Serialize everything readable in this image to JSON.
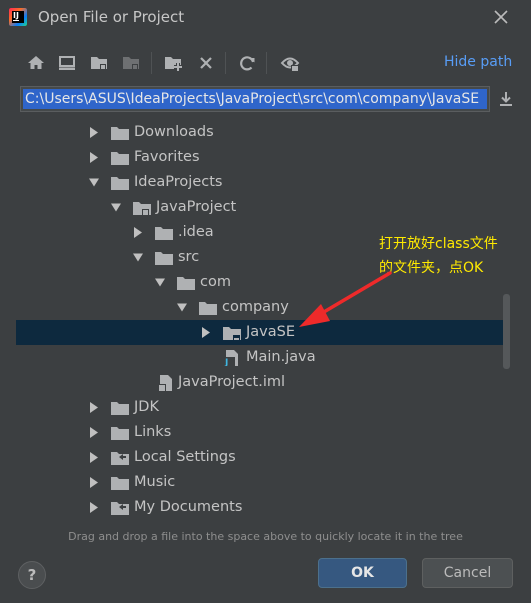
{
  "window": {
    "title": "Open File or Project",
    "close_icon": "close-icon"
  },
  "toolbar": {
    "icons": [
      "home-icon",
      "desktop-icon",
      "project-folder-icon",
      "module-folder-icon",
      "new-folder-icon",
      "delete-icon",
      "refresh-icon",
      "show-hidden-icon"
    ],
    "hide_path_label": "Hide path"
  },
  "path_field": {
    "value": "C:\\Users\\ASUS\\IdeaProjects\\JavaProject\\src\\com\\company\\JavaSE"
  },
  "tree": {
    "rows": [
      {
        "label": "Downloads"
      },
      {
        "label": "Favorites"
      },
      {
        "label": "IdeaProjects"
      },
      {
        "label": "JavaProject"
      },
      {
        "label": ".idea"
      },
      {
        "label": "src"
      },
      {
        "label": "com"
      },
      {
        "label": "company"
      },
      {
        "label": "JavaSE",
        "selected": true
      },
      {
        "label": "Main.java"
      },
      {
        "label": "JavaProject.iml"
      },
      {
        "label": "JDK"
      },
      {
        "label": "Links"
      },
      {
        "label": "Local Settings"
      },
      {
        "label": "Music"
      },
      {
        "label": "My Documents"
      }
    ]
  },
  "annotation": {
    "line1": "打开放好class文件",
    "line2": "的文件夹，点OK",
    "color": "#ffea00"
  },
  "hint": "Drag and drop a file into the space above to quickly locate it in the tree",
  "buttons": {
    "help": "?",
    "ok": "OK",
    "cancel": "Cancel"
  },
  "colors": {
    "background": "#3c3f41",
    "selection": "#0d293e",
    "path_selection": "#2f65ca",
    "link": "#589df6",
    "ok_button": "#365880",
    "arrow": "#ee2a2a"
  }
}
